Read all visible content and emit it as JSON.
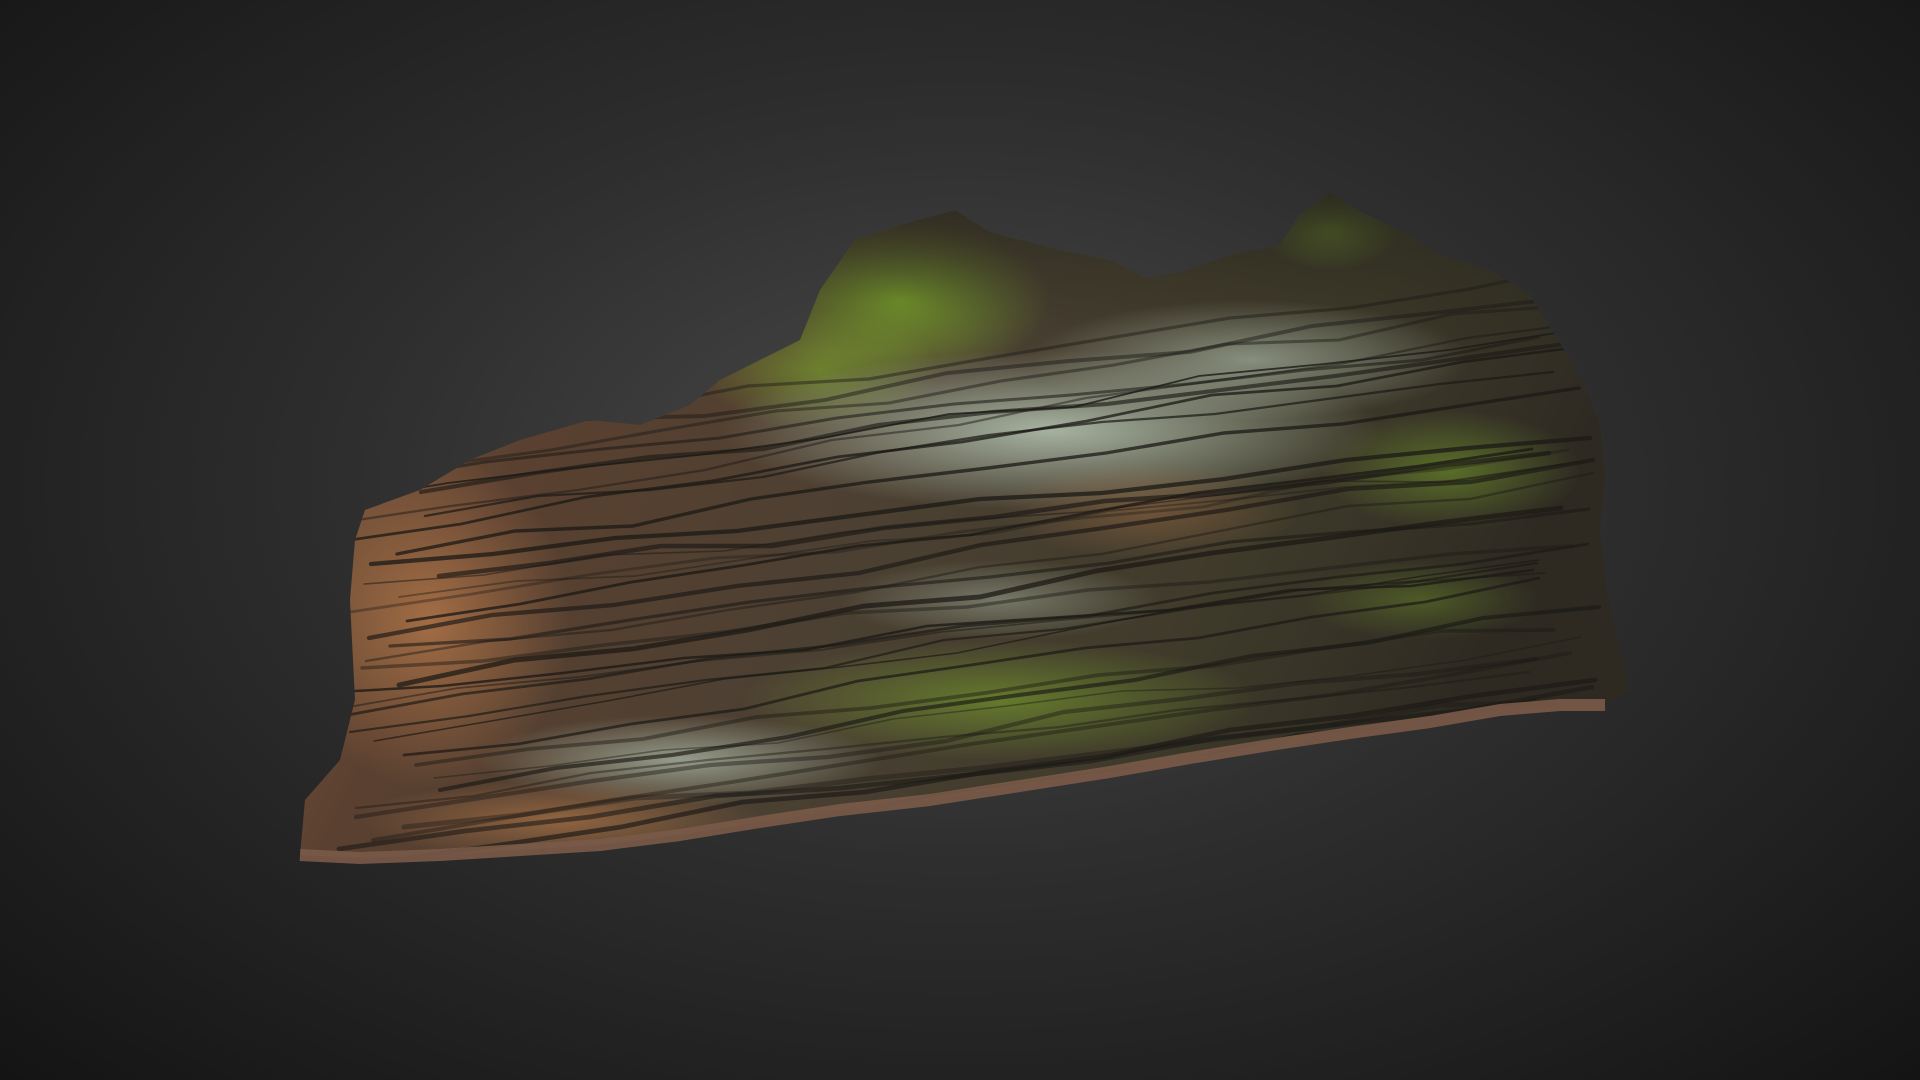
{
  "scene": {
    "background_center": "#4a4a4a",
    "background_edge": "#141414"
  },
  "model": {
    "subject": "rock-outcrop",
    "colors": {
      "sandstone_orange": "#9a6a45",
      "sandstone_dark": "#3a2c22",
      "lichen_pale": "#9fb0a0",
      "moss_green": "#6f8a2a",
      "moss_bright": "#8fbf2e",
      "shadow": "#1c1a16",
      "edge_brown": "#7a5a48"
    }
  }
}
